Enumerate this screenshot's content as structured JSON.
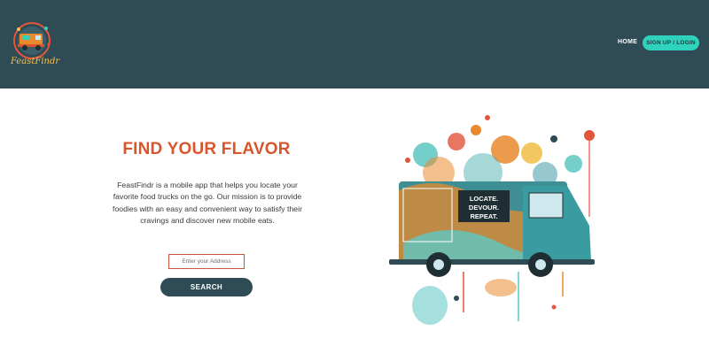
{
  "header": {
    "logo_text": "FeastFindr",
    "nav": {
      "home": "HOME",
      "signup": "SIGN UP / LOGIN"
    }
  },
  "hero": {
    "title": "FIND YOUR FLAVOR",
    "description": "FeastFindr is a mobile app that helps you locate your favorite food trucks on the go. Our mission is to provide foodies with an easy and convenient way to satisfy their cravings and discover new mobile eats.",
    "address_placeholder": "Enter your Address",
    "search_label": "SEARCH"
  },
  "illustration": {
    "sign_lines": [
      "LOCATE.",
      "DEVOUR.",
      "REPEAT."
    ]
  },
  "colors": {
    "header_bg": "#2f4b55",
    "accent_orange": "#d9552c",
    "accent_teal": "#2fd2bc"
  }
}
